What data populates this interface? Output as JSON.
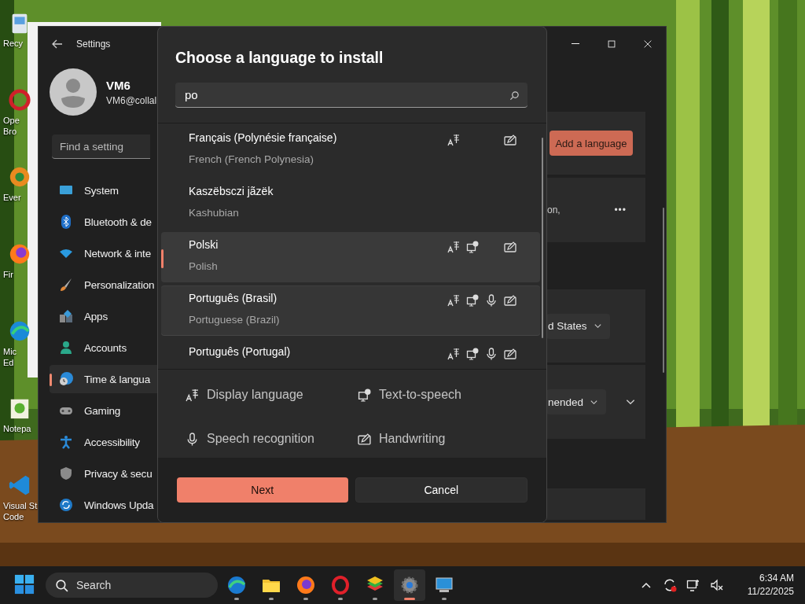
{
  "desktop": {
    "icons": [
      {
        "label": "Recy"
      },
      {
        "label": "Ope\nBro"
      },
      {
        "label": "Ever"
      },
      {
        "label": "Fir"
      },
      {
        "label": "Mic\nEd"
      },
      {
        "label": "Notepa"
      },
      {
        "label": "Visual St\nCode"
      }
    ]
  },
  "settings": {
    "title": "Settings",
    "user": {
      "name": "VM6",
      "email": "VM6@collal"
    },
    "search": {
      "placeholder": "Find a setting"
    },
    "nav": [
      {
        "label": "System",
        "selected": false
      },
      {
        "label": "Bluetooth & de",
        "selected": false
      },
      {
        "label": "Network & inte",
        "selected": false
      },
      {
        "label": "Personalization",
        "selected": false
      },
      {
        "label": "Apps",
        "selected": false
      },
      {
        "label": "Accounts",
        "selected": false
      },
      {
        "label": "Time & langua",
        "selected": true
      },
      {
        "label": "Gaming",
        "selected": false
      },
      {
        "label": "Accessibility",
        "selected": false
      },
      {
        "label": "Privacy & secu",
        "selected": false
      },
      {
        "label": "Windows Upda",
        "selected": false
      }
    ],
    "content": {
      "add_button": "Add a language",
      "card_text": "on,",
      "more": "•••",
      "region_dropdown": "d States",
      "format_dropdown": "nended"
    }
  },
  "dialog": {
    "title": "Choose a language to install",
    "search": {
      "value": "po"
    },
    "languages": [
      {
        "name": "Français (Polynésie française)",
        "english": "French (French Polynesia)",
        "selected": false,
        "hovered": false,
        "display_language": true,
        "text_to_speech": false,
        "speech_recognition": false,
        "handwriting": true
      },
      {
        "name": "Kaszëbsczi jãzëk",
        "english": "Kashubian",
        "selected": false,
        "hovered": false,
        "display_language": false,
        "text_to_speech": false,
        "speech_recognition": false,
        "handwriting": false
      },
      {
        "name": "Polski",
        "english": "Polish",
        "selected": true,
        "hovered": false,
        "display_language": true,
        "text_to_speech": true,
        "speech_recognition": false,
        "handwriting": true
      },
      {
        "name": "Português (Brasil)",
        "english": "Portuguese (Brazil)",
        "selected": false,
        "hovered": true,
        "display_language": true,
        "text_to_speech": true,
        "speech_recognition": true,
        "handwriting": true
      },
      {
        "name": "Português (Portugal)",
        "selected": false,
        "hovered": false,
        "display_language": true,
        "text_to_speech": true,
        "speech_recognition": true,
        "handwriting": true
      }
    ],
    "legend": [
      "Display language",
      "Text-to-speech",
      "Speech recognition",
      "Handwriting"
    ],
    "buttons": [
      {
        "label": "Next",
        "kind": "primary"
      },
      {
        "label": "Cancel",
        "kind": "secondary"
      }
    ]
  },
  "taskbar": {
    "search": {
      "placeholder": "Search"
    },
    "apps": [
      {
        "selected": false
      },
      {
        "selected": false
      },
      {
        "selected": false
      },
      {
        "selected": false
      },
      {
        "selected": false
      },
      {
        "selected": true
      },
      {
        "selected": false
      }
    ],
    "time": "6:34 AM",
    "date": "11/22/2025"
  }
}
